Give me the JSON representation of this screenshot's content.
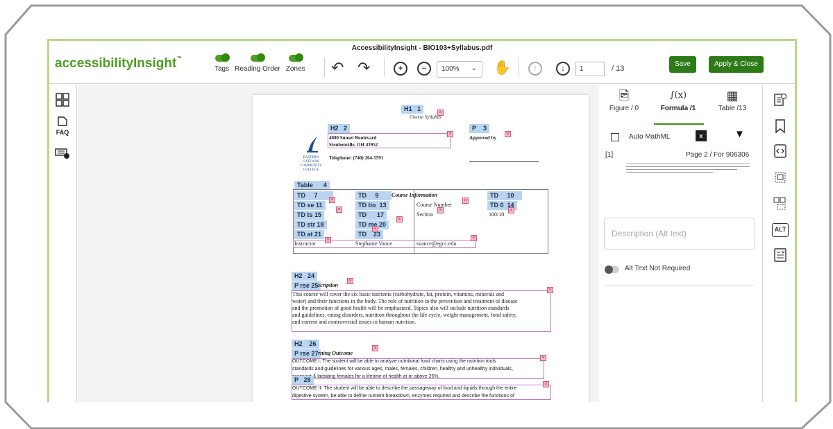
{
  "app": {
    "logo_prefix": "accessibility",
    "logo_mid": "Insight",
    "logo_tm": "™",
    "doc_title": "AccessibilityInsight - BIO103+Syllabus.pdf"
  },
  "toolbar": {
    "toggles": [
      {
        "label": "Tags"
      },
      {
        "label": "Reading Order"
      },
      {
        "label": "Zones"
      }
    ],
    "zoom": "100%",
    "page_current": "1",
    "page_total": "/ 13",
    "save_label": "Save",
    "apply_label": "Apply & Close"
  },
  "left_sidebar": {
    "faq_label": "FAQ"
  },
  "pdf": {
    "tags": {
      "h1": "H1",
      "n1": "1",
      "h2a": "H2",
      "n2": "2",
      "p3": "P",
      "n3": "3",
      "table": "Table",
      "n4": "4",
      "h2b": "H2",
      "n24": "24",
      "h2c": "H2",
      "n26": "26",
      "p28": "P",
      "n28": "28"
    },
    "course_syllabus": "Course Syllabus",
    "address_line1": "4000 Sunset Boulevard",
    "address_line2": "Steubenville, OH 43952",
    "approved_by": "Approved by",
    "telephone": "Telephone: (740) 264-5591",
    "college_name": "EASTERN GATEWAY COMMUNITY COLLEGE",
    "table_rows": [
      {
        "a": "TD",
        "an": "7",
        "b": "TD",
        "bn": "9",
        "c": "Course Information",
        "d": "TD",
        "dn": "10"
      },
      {
        "a": "TD se",
        "an": "11",
        "b": "TD tio",
        "bn": "13",
        "c": "Course Number",
        "d": "TD 0",
        "dn": "14"
      },
      {
        "a": "TD ts",
        "an": "15",
        "b": "TD",
        "bn": "17",
        "c": "Section",
        "d": "100/10",
        "dn": ""
      },
      {
        "a": "TD str",
        "an": "18",
        "b": "TD me",
        "bn": "20",
        "c": "",
        "d": "",
        "dn": ""
      },
      {
        "a": "TD at",
        "an": "21",
        "b": "TD",
        "bn": "23",
        "c": "",
        "d": "",
        "dn": ""
      }
    ],
    "instructor": "Instructor",
    "instructor_name": "Stephanie Vance",
    "instructor_email": "svance@egcc.edu",
    "p_desc": "P rse",
    "n25": "25",
    "desc_heading": "scription",
    "desc_lines": [
      "This course will cover the six basic nutrients (carbohydrate, fat, protein, vitamins, minerals and",
      "water) and their functions in the body. The role of nutrition in the prevention and treatment of disease",
      "and the promotion of good health will be emphasized. Topics also will include nutrition standards",
      "and guidelines, eating disorders, nutrition throughout the life cycle, weight management, food safety,",
      "and current and controversial issues in human nutrition."
    ],
    "p_outcome": "P rse",
    "n27": "27",
    "outcome_heading": "rning Outcome",
    "outcome1_lines": [
      "OUTCOME I: The student will be able to analyze nutritional food charts using the nutrition tools",
      "standards and guidelines for various ages, males, females, children, healthy and unhealthy individuals,",
      "pregnant & lactating females for a lifetime of health at or above 25%."
    ],
    "outcome2_lines": [
      "OUTCOME II: The student will be able to describe the passageway of food and liquids through the entire",
      "digestive system, be able to define nutrient breakdown, enzymes required and describe the functions of"
    ]
  },
  "right_panel": {
    "tabs": [
      {
        "label": "Figure / 0"
      },
      {
        "label": "Formula /1"
      },
      {
        "label": "Table /13"
      }
    ],
    "auto_mathml": "Auto MathML",
    "index": "[1]",
    "page_info": "Page 2 / For 906306",
    "alt_placeholder": "Description (Alt text)",
    "alt_not_required": "Alt Text Not Required"
  },
  "right_sidebar": {
    "alt_label": "ALT"
  },
  "colors": {
    "accent": "#2f7a18",
    "tag_bg": "#b9d4f0",
    "frame_border": "#b8d888"
  }
}
